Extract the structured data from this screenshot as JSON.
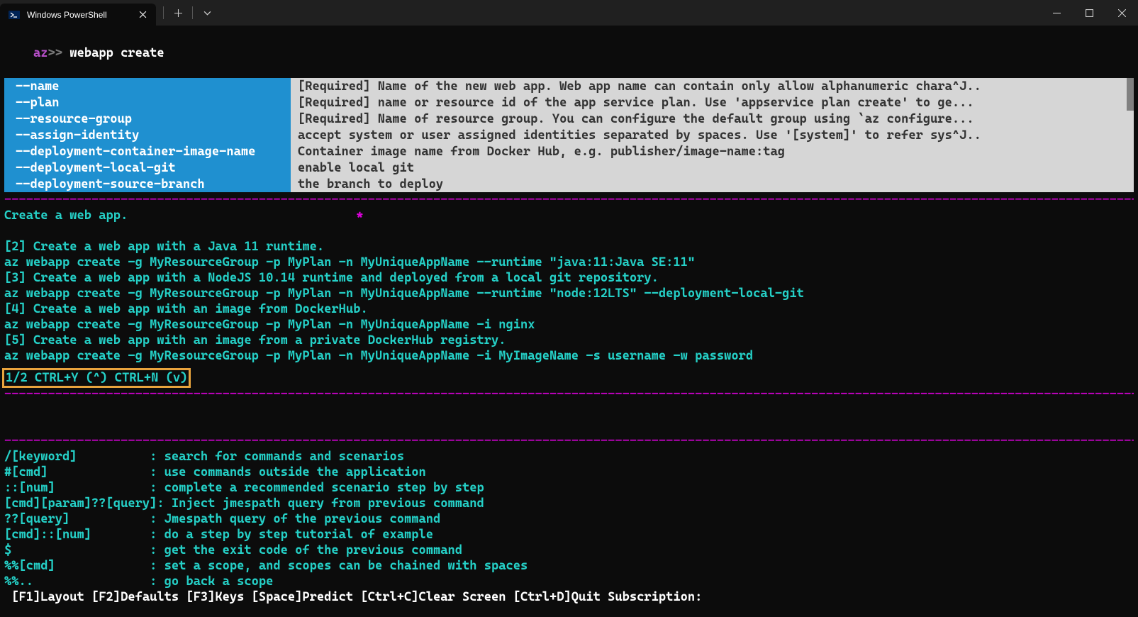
{
  "window": {
    "tab_title": "Windows PowerShell"
  },
  "prompt": {
    "az": "az",
    "arrows": ">>",
    "command": "webapp create"
  },
  "completions": [
    {
      "flag": "--name",
      "desc": "[Required] Name of the new web app. Web app name can contain only allow alphanumeric chara^J.."
    },
    {
      "flag": "--plan",
      "desc": "[Required] name or resource id of the app service plan. Use 'appservice plan create' to ge..."
    },
    {
      "flag": "--resource-group",
      "desc": "[Required] Name of resource group. You can configure the default group using `az configure..."
    },
    {
      "flag": "--assign-identity",
      "desc": "accept system or user assigned identities separated by spaces. Use '[system]' to refer sys^J.."
    },
    {
      "flag": "--deployment-container-image-name",
      "desc": "Container image name from Docker Hub, e.g. publisher/image-name:tag"
    },
    {
      "flag": "--deployment-local-git",
      "desc": "enable local git"
    },
    {
      "flag": "--deployment-source-branch",
      "desc": "the branch to deploy"
    }
  ],
  "description": {
    "title": "Create a web app.",
    "star": "*",
    "examples": [
      "[2] Create a web app with a Java 11 runtime.",
      "az webapp create -g MyResourceGroup -p MyPlan -n MyUniqueAppName --runtime \"java:11:Java SE:11\"",
      "[3] Create a web app with a NodeJS 10.14 runtime and deployed from a local git repository.",
      "az webapp create -g MyResourceGroup -p MyPlan -n MyUniqueAppName --runtime \"node:12LTS\" --deployment-local-git",
      "[4] Create a web app with an image from DockerHub.",
      "az webapp create -g MyResourceGroup -p MyPlan -n MyUniqueAppName -i nginx",
      "[5] Create a web app with an image from a private DockerHub registry.",
      "az webapp create -g MyResourceGroup -p MyPlan -n MyUniqueAppName -i MyImageName -s username -w password"
    ],
    "pager": "1/2 CTRL+Y (^) CTRL+N (v)"
  },
  "help": [
    {
      "key": "/[keyword]          ",
      "desc": ": search for commands and scenarios"
    },
    {
      "key": "#[cmd]              ",
      "desc": ": use commands outside the application"
    },
    {
      "key": "::[num]             ",
      "desc": ": complete a recommended scenario step by step"
    },
    {
      "key": "[cmd][param]??[query]",
      "desc": ": Inject jmespath query from previous command"
    },
    {
      "key": "??[query]           ",
      "desc": ": Jmespath query of the previous command"
    },
    {
      "key": "[cmd]::[num]        ",
      "desc": ": do a step by step tutorial of example"
    },
    {
      "key": "$                   ",
      "desc": ": get the exit code of the previous command"
    },
    {
      "key": "%%[cmd]             ",
      "desc": ": set a scope, and scopes can be chained with spaces"
    },
    {
      "key": "%%..                ",
      "desc": ": go back a scope"
    }
  ],
  "statusbar": " [F1]Layout [F2]Defaults [F3]Keys [Space]Predict [Ctrl+C]Clear Screen [Ctrl+D]Quit Subscription:",
  "dashes": "--------------------------------------------------------------------------------------------------------------------------------------------------------------------"
}
